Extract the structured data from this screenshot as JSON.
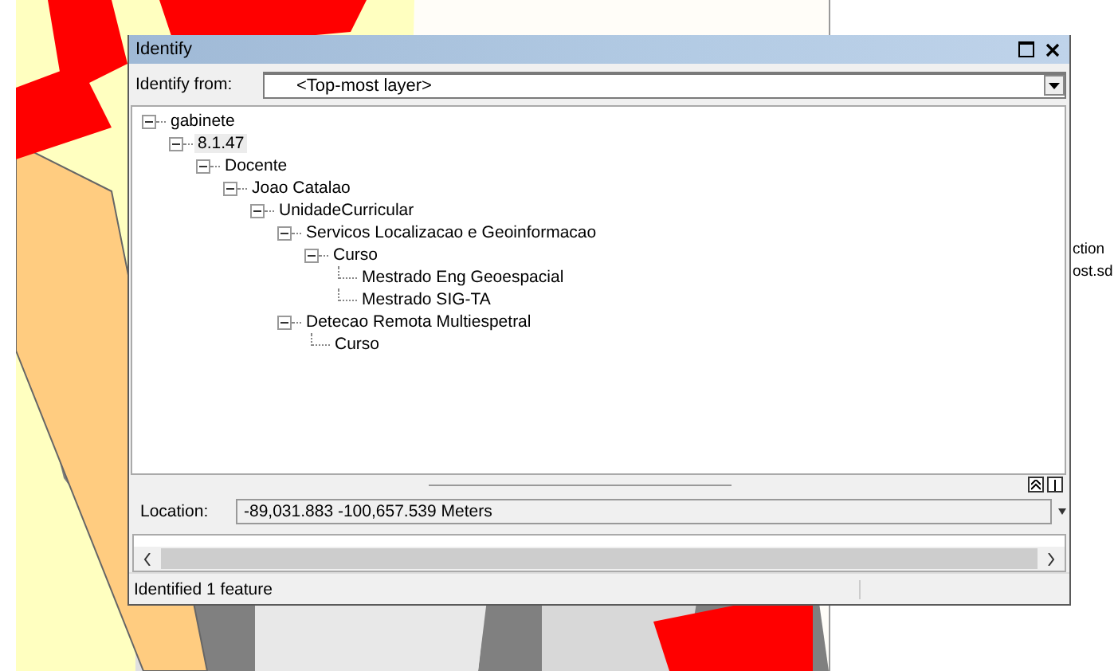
{
  "catalog": {
    "items": [
      "ction",
      "ost.sd"
    ]
  },
  "window": {
    "title": "Identify"
  },
  "identify_from": {
    "label": "Identify from:",
    "value": "<Top-most layer>"
  },
  "tree": [
    {
      "label": "gabinete",
      "expanded": true,
      "selected": false,
      "children": [
        {
          "label": "8.1.47",
          "expanded": true,
          "selected": true,
          "children": [
            {
              "label": "Docente",
              "expanded": true,
              "selected": false,
              "children": [
                {
                  "label": "Joao Catalao",
                  "expanded": true,
                  "selected": false,
                  "children": [
                    {
                      "label": "UnidadeCurricular",
                      "expanded": true,
                      "selected": false,
                      "children": [
                        {
                          "label": "Servicos Localizacao e Geoinformacao",
                          "expanded": true,
                          "selected": false,
                          "children": [
                            {
                              "label": "Curso",
                              "expanded": true,
                              "selected": false,
                              "children": [
                                {
                                  "label": "Mestrado Eng Geoespacial",
                                  "selected": false
                                },
                                {
                                  "label": "Mestrado SIG-TA",
                                  "selected": false
                                }
                              ]
                            }
                          ]
                        },
                        {
                          "label": "Detecao Remota Multiespetral",
                          "expanded": true,
                          "selected": false,
                          "children": [
                            {
                              "label": "Curso",
                              "selected": false
                            }
                          ]
                        }
                      ]
                    }
                  ]
                }
              ]
            }
          ]
        }
      ]
    }
  ],
  "location": {
    "label": "Location:",
    "value": "-89,031.883  -100,657.539 Meters"
  },
  "status_bar": "Identified 1 feature"
}
